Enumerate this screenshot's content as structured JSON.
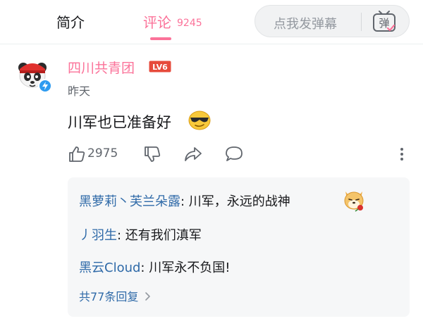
{
  "tabs": {
    "intro_label": "简介",
    "comments_label": "评论",
    "comments_count": "9245"
  },
  "danmaku": {
    "placeholder": "点我发弹幕",
    "toggle_glyph": "弹"
  },
  "comment": {
    "username": "四川共青团",
    "level": "LV6",
    "time": "昨天",
    "content": "川军也已准备好",
    "emoji": "sunglasses-emoji",
    "likes": "2975"
  },
  "replies": [
    {
      "user": "黑萝莉丶芙兰朵露",
      "text": ": 川军，永远的战神",
      "emoji": "shiba-dog-rose-emoji"
    },
    {
      "user": "丿羽生",
      "text": ": 还有我们滇军"
    },
    {
      "user": "黑云Cloud",
      "text": ": 川军永不负国!"
    }
  ],
  "more_replies": "共77条回复",
  "colors": {
    "accent_pink": "#fb7299",
    "link_blue": "#2f6aa8",
    "level_red": "#e64a3b",
    "verify_blue": "#2e9bf0"
  }
}
